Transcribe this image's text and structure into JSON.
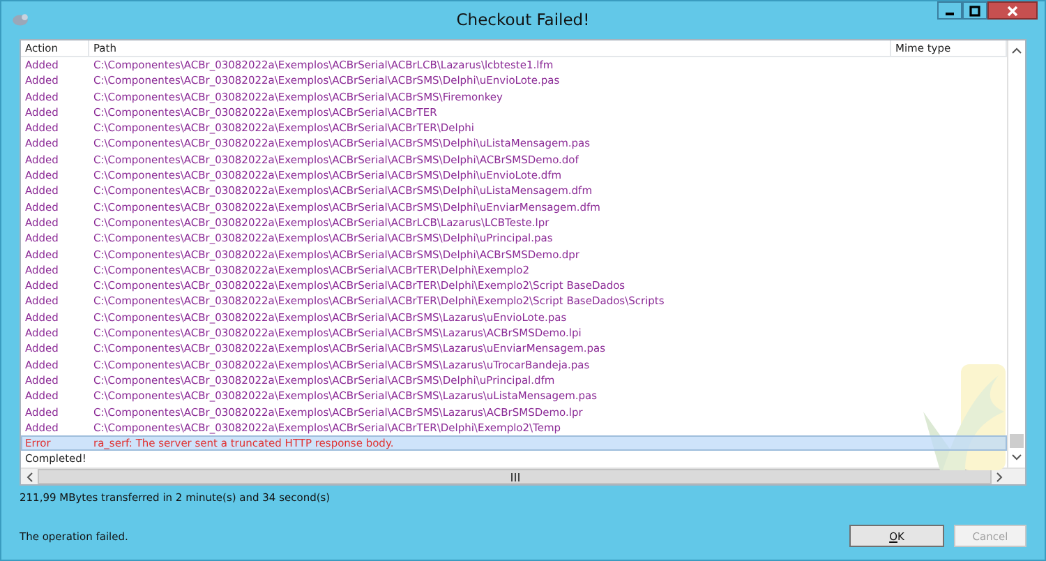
{
  "window": {
    "title": "Checkout Failed!"
  },
  "table": {
    "columns": [
      "Action",
      "Path",
      "Mime type"
    ],
    "rows": [
      {
        "kind": "added",
        "action": "Added",
        "path": "C:\\Componentes\\ACBr_03082022a\\Exemplos\\ACBrSerial\\ACBrLCB\\Lazarus\\lcbteste1.lfm",
        "selected": false
      },
      {
        "kind": "added",
        "action": "Added",
        "path": "C:\\Componentes\\ACBr_03082022a\\Exemplos\\ACBrSerial\\ACBrSMS\\Delphi\\uEnvioLote.pas",
        "selected": false
      },
      {
        "kind": "added",
        "action": "Added",
        "path": "C:\\Componentes\\ACBr_03082022a\\Exemplos\\ACBrSerial\\ACBrSMS\\Firemonkey",
        "selected": false
      },
      {
        "kind": "added",
        "action": "Added",
        "path": "C:\\Componentes\\ACBr_03082022a\\Exemplos\\ACBrSerial\\ACBrTER",
        "selected": false
      },
      {
        "kind": "added",
        "action": "Added",
        "path": "C:\\Componentes\\ACBr_03082022a\\Exemplos\\ACBrSerial\\ACBrTER\\Delphi",
        "selected": false
      },
      {
        "kind": "added",
        "action": "Added",
        "path": "C:\\Componentes\\ACBr_03082022a\\Exemplos\\ACBrSerial\\ACBrSMS\\Delphi\\uListaMensagem.pas",
        "selected": false
      },
      {
        "kind": "added",
        "action": "Added",
        "path": "C:\\Componentes\\ACBr_03082022a\\Exemplos\\ACBrSerial\\ACBrSMS\\Delphi\\ACBrSMSDemo.dof",
        "selected": false
      },
      {
        "kind": "added",
        "action": "Added",
        "path": "C:\\Componentes\\ACBr_03082022a\\Exemplos\\ACBrSerial\\ACBrSMS\\Delphi\\uEnvioLote.dfm",
        "selected": false
      },
      {
        "kind": "added",
        "action": "Added",
        "path": "C:\\Componentes\\ACBr_03082022a\\Exemplos\\ACBrSerial\\ACBrSMS\\Delphi\\uListaMensagem.dfm",
        "selected": false
      },
      {
        "kind": "added",
        "action": "Added",
        "path": "C:\\Componentes\\ACBr_03082022a\\Exemplos\\ACBrSerial\\ACBrSMS\\Delphi\\uEnviarMensagem.dfm",
        "selected": false
      },
      {
        "kind": "added",
        "action": "Added",
        "path": "C:\\Componentes\\ACBr_03082022a\\Exemplos\\ACBrSerial\\ACBrLCB\\Lazarus\\LCBTeste.lpr",
        "selected": false
      },
      {
        "kind": "added",
        "action": "Added",
        "path": "C:\\Componentes\\ACBr_03082022a\\Exemplos\\ACBrSerial\\ACBrSMS\\Delphi\\uPrincipal.pas",
        "selected": false
      },
      {
        "kind": "added",
        "action": "Added",
        "path": "C:\\Componentes\\ACBr_03082022a\\Exemplos\\ACBrSerial\\ACBrSMS\\Delphi\\ACBrSMSDemo.dpr",
        "selected": false
      },
      {
        "kind": "added",
        "action": "Added",
        "path": "C:\\Componentes\\ACBr_03082022a\\Exemplos\\ACBrSerial\\ACBrTER\\Delphi\\Exemplo2",
        "selected": false
      },
      {
        "kind": "added",
        "action": "Added",
        "path": "C:\\Componentes\\ACBr_03082022a\\Exemplos\\ACBrSerial\\ACBrTER\\Delphi\\Exemplo2\\Script BaseDados",
        "selected": false
      },
      {
        "kind": "added",
        "action": "Added",
        "path": "C:\\Componentes\\ACBr_03082022a\\Exemplos\\ACBrSerial\\ACBrTER\\Delphi\\Exemplo2\\Script BaseDados\\Scripts",
        "selected": false
      },
      {
        "kind": "added",
        "action": "Added",
        "path": "C:\\Componentes\\ACBr_03082022a\\Exemplos\\ACBrSerial\\ACBrSMS\\Lazarus\\uEnvioLote.pas",
        "selected": false
      },
      {
        "kind": "added",
        "action": "Added",
        "path": "C:\\Componentes\\ACBr_03082022a\\Exemplos\\ACBrSerial\\ACBrSMS\\Lazarus\\ACBrSMSDemo.lpi",
        "selected": false
      },
      {
        "kind": "added",
        "action": "Added",
        "path": "C:\\Componentes\\ACBr_03082022a\\Exemplos\\ACBrSerial\\ACBrSMS\\Lazarus\\uEnviarMensagem.pas",
        "selected": false
      },
      {
        "kind": "added",
        "action": "Added",
        "path": "C:\\Componentes\\ACBr_03082022a\\Exemplos\\ACBrSerial\\ACBrSMS\\Lazarus\\uTrocarBandeja.pas",
        "selected": false
      },
      {
        "kind": "added",
        "action": "Added",
        "path": "C:\\Componentes\\ACBr_03082022a\\Exemplos\\ACBrSerial\\ACBrSMS\\Delphi\\uPrincipal.dfm",
        "selected": false
      },
      {
        "kind": "added",
        "action": "Added",
        "path": "C:\\Componentes\\ACBr_03082022a\\Exemplos\\ACBrSerial\\ACBrSMS\\Lazarus\\uListaMensagem.pas",
        "selected": false
      },
      {
        "kind": "added",
        "action": "Added",
        "path": "C:\\Componentes\\ACBr_03082022a\\Exemplos\\ACBrSerial\\ACBrSMS\\Lazarus\\ACBrSMSDemo.lpr",
        "selected": false
      },
      {
        "kind": "added",
        "action": "Added",
        "path": "C:\\Componentes\\ACBr_03082022a\\Exemplos\\ACBrSerial\\ACBrTER\\Delphi\\Exemplo2\\Temp",
        "selected": false
      },
      {
        "kind": "error",
        "action": "Error",
        "path": "ra_serf: The server sent a truncated HTTP response body.",
        "selected": true
      },
      {
        "kind": "completed",
        "action": "Completed!",
        "selected": false
      }
    ]
  },
  "transfer_info": "211,99 MBytes transferred in 2 minute(s) and 34 second(s)",
  "message": "The operation failed.",
  "buttons": [
    {
      "label": "OK",
      "disabled": false
    },
    {
      "label": "Cancel",
      "disabled": true
    }
  ]
}
